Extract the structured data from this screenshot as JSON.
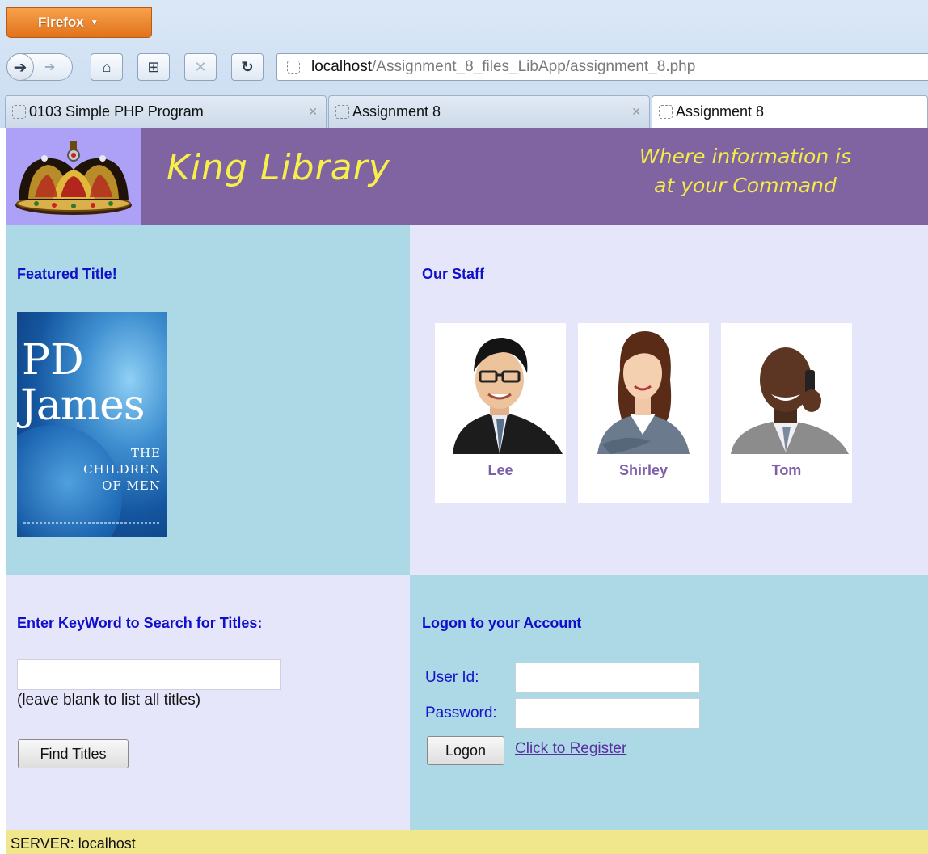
{
  "browser": {
    "menu_label": "Firefox",
    "url_host": "localhost",
    "url_path": "/Assignment_8_files_LibApp/assignment_8.php",
    "tabs": [
      {
        "label": "0103 Simple PHP Program"
      },
      {
        "label": "Assignment 8"
      },
      {
        "label": "Assignment 8"
      }
    ]
  },
  "banner": {
    "title": "King Library",
    "tagline_line1": "Where information is",
    "tagline_line2": "at your Command"
  },
  "featured": {
    "heading": "Featured Title!",
    "book": {
      "author_line1": "PD",
      "author_line2": "James",
      "title_line1": "THE",
      "title_line2": "CHILDREN",
      "title_line3": "OF MEN"
    }
  },
  "staff": {
    "heading": "Our Staff",
    "members": [
      {
        "name": "Lee"
      },
      {
        "name": "Shirley"
      },
      {
        "name": "Tom"
      }
    ]
  },
  "search": {
    "heading": "Enter KeyWord to Search for Titles:",
    "keyword_value": "",
    "hint": "(leave blank to list all titles)",
    "button_label": "Find Titles"
  },
  "logon": {
    "heading": "Logon to your Account",
    "user_label": "User Id:",
    "password_label": "Password:",
    "user_value": "",
    "password_value": "",
    "button_label": "Logon",
    "register_link": "Click to Register"
  },
  "footer": {
    "server_text": "SERVER: localhost"
  },
  "colors": {
    "banner": "#8064a2",
    "logo_bg": "#ada1f7",
    "panel_blue": "#add8e6",
    "panel_lavender": "#e6e6fa",
    "footer": "#f0e68c",
    "heading": "#1010cc",
    "title_yellow": "#f7f04a"
  }
}
